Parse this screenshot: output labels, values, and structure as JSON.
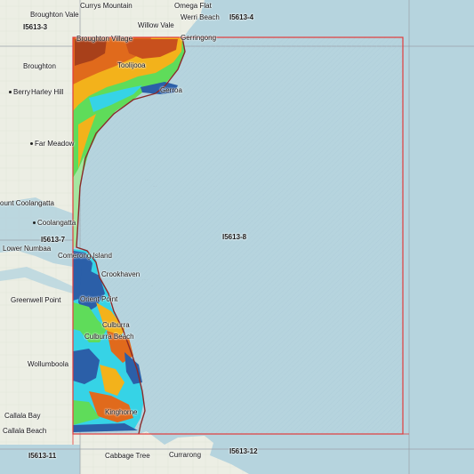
{
  "tiles": {
    "t3": "I5613-3",
    "t4": "I5613-4",
    "t7": "I5613-7",
    "t8": "I5613-8",
    "t11": "I5613-11",
    "t12": "I5613-12"
  },
  "places": {
    "broughton_vale_top": "Broughton Vale",
    "currys_mountain": "Currys Mountain",
    "omega_flat": "Omega Flat",
    "werri_beach": "Werri Beach",
    "willow_vale": "Willow Vale",
    "broughton_village": "Broughton Village",
    "gerringong": "Gerringong",
    "broughton": "Broughton",
    "toolijooa": "Toolijooa",
    "berry": "Berry",
    "harley_hill": "Harley Hill",
    "gerroa": "Gerroa",
    "far_meadow": "Far Meadow",
    "mount_coolangatta": "ount Coolangatta",
    "coolangatta": "Coolangatta",
    "lower_numbaa": "Lower Numbaa",
    "comerong_island": "Comerong Island",
    "crookhaven": "Crookhaven",
    "greenwell_point": "Greenwell Point",
    "orient_point": "Orient Point",
    "culburra": "Culburra",
    "culburra_beach": "Culburra Beach",
    "wollumboola": "Wollumboola",
    "callala_bay": "Callala Bay",
    "kinghorne": "Kinghorne",
    "callala_beach": "Callala Beach",
    "cabbage_tree": "Cabbage Tree",
    "currarong": "Currarong"
  },
  "colors": {
    "ocean": "#b6d4de",
    "land": "#eef0e6",
    "tile_border": "#e23b3b",
    "terrain_high": "#c8501d",
    "terrain_mid": "#f3b21b",
    "terrain_low_green": "#5fdc5a",
    "terrain_cyan": "#36d3e6",
    "terrain_deep": "#2b5fa8"
  }
}
